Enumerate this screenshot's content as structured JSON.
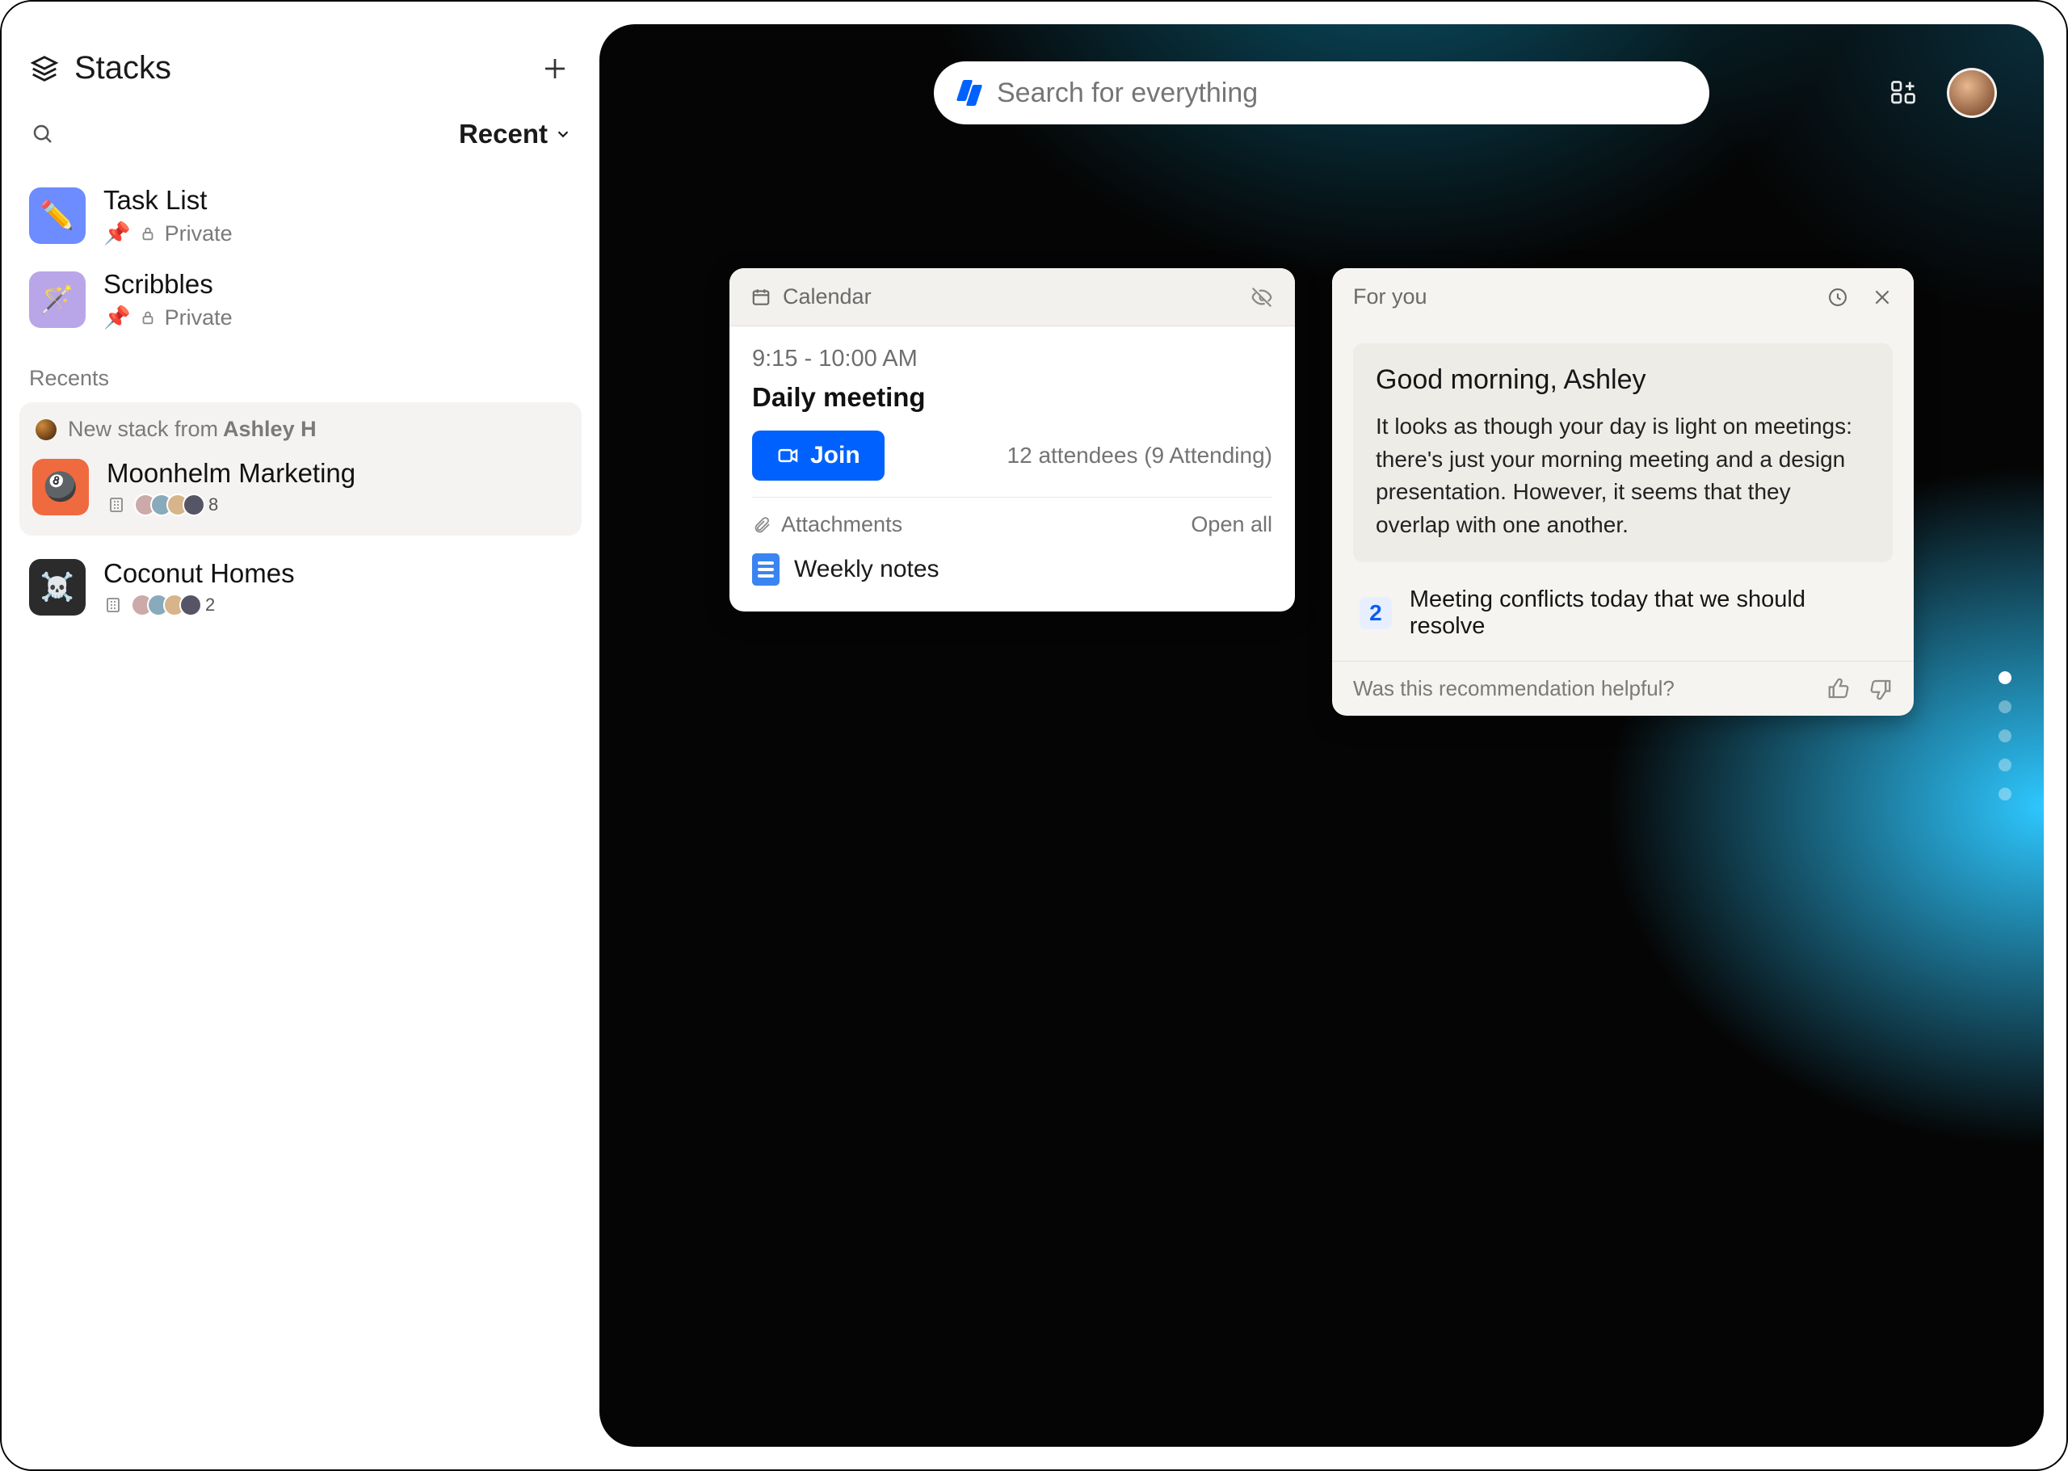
{
  "sidebar": {
    "title": "Stacks",
    "sort_label": "Recent",
    "recents_label": "Recents",
    "pinned": [
      {
        "name": "Task List",
        "visibility": "Private",
        "icon": "✏️",
        "icon_bg": "blue"
      },
      {
        "name": "Scribbles",
        "visibility": "Private",
        "icon": "🪄",
        "icon_bg": "purple"
      }
    ],
    "recents_banner_prefix": "New stack from",
    "recents_banner_author": "Ashley H",
    "recents": [
      {
        "name": "Moonhelm Marketing",
        "member_count": "8",
        "icon": "🎱",
        "icon_bg": "orange"
      },
      {
        "name": "Coconut Homes",
        "member_count": "2",
        "icon": "☠️",
        "icon_bg": "dark"
      }
    ]
  },
  "search": {
    "placeholder": "Search for everything"
  },
  "calendar_card": {
    "header_label": "Calendar",
    "time_range": "9:15 - 10:00 AM",
    "event_title": "Daily meeting",
    "join_label": "Join",
    "attendees_text": "12 attendees (9 Attending)",
    "attachments_label": "Attachments",
    "open_all_label": "Open all",
    "attachment_name": "Weekly notes"
  },
  "foryou_card": {
    "header_label": "For you",
    "greeting": "Good morning, Ashley",
    "summary": "It looks as though your day is light on meetings: there's just your morning meeting and a design presentation. However, it seems that they overlap with one another.",
    "action_count": "2",
    "action_text": "Meeting conflicts today that we should resolve",
    "feedback_prompt": "Was this recommendation helpful?"
  }
}
